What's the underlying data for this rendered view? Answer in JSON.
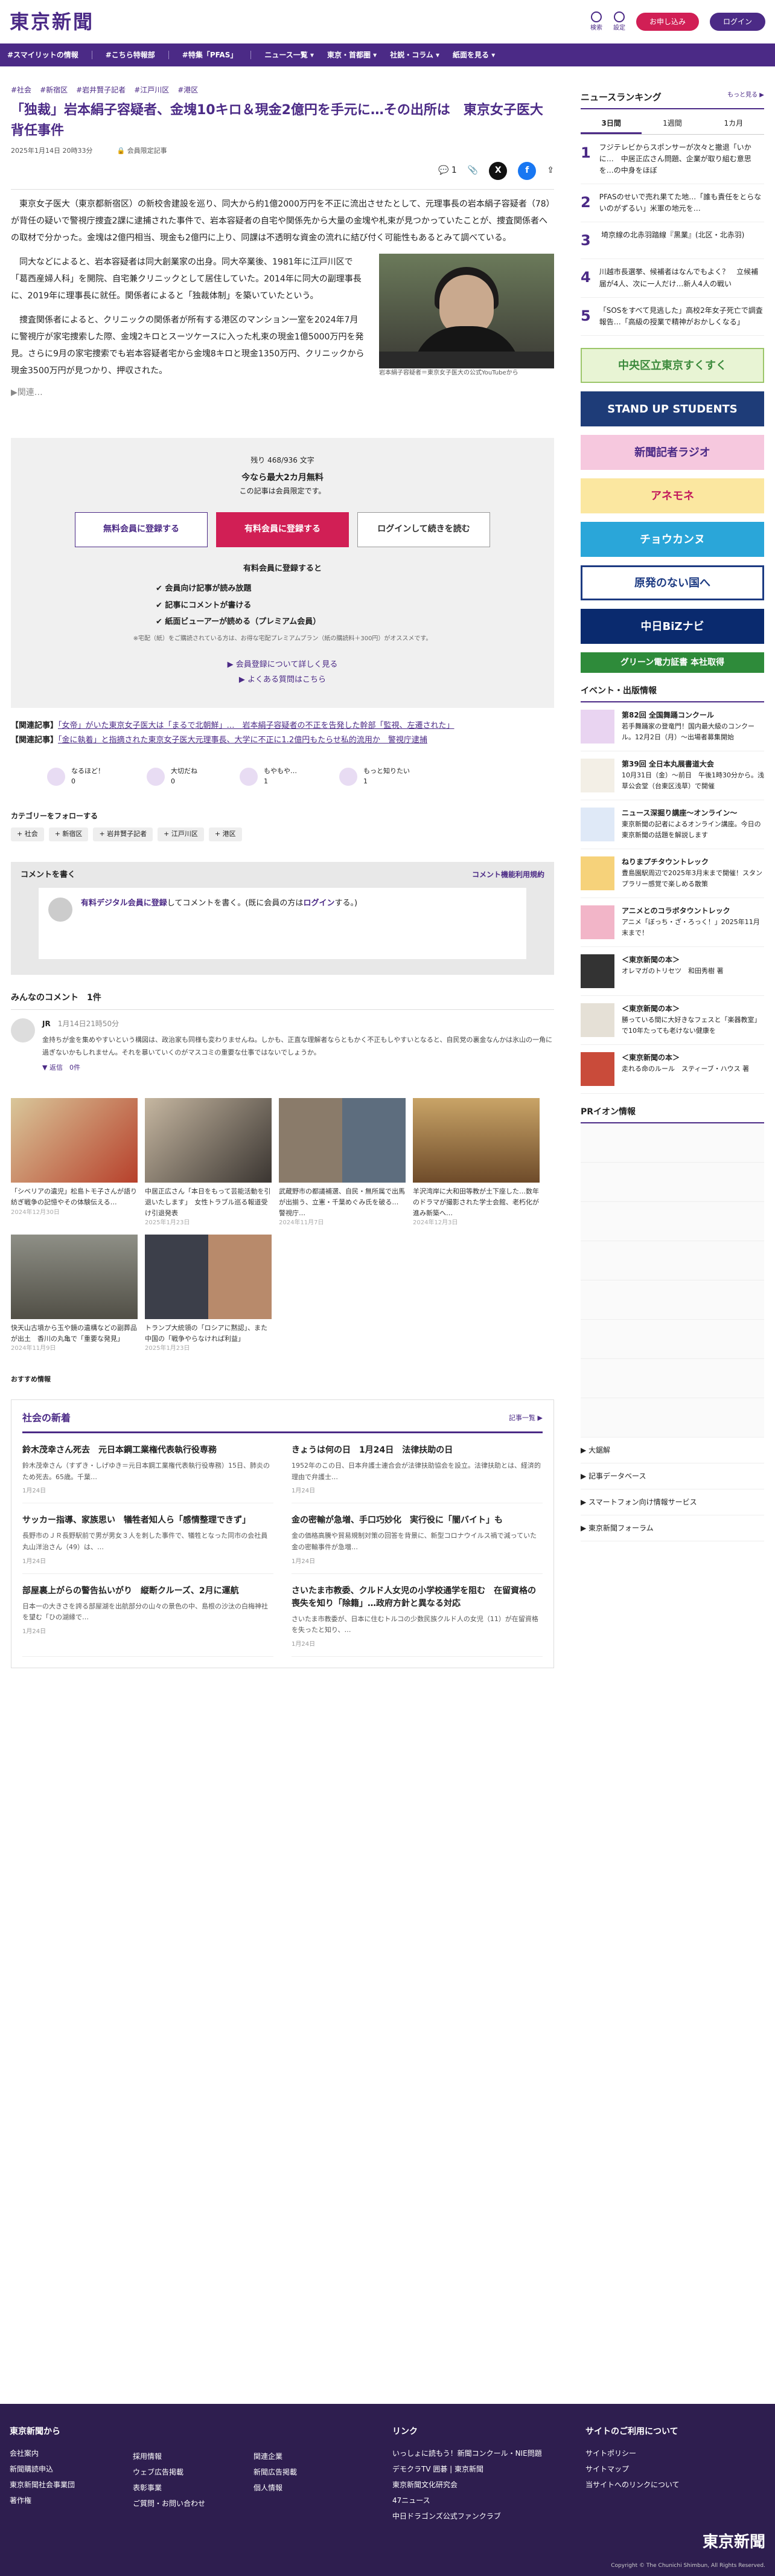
{
  "header": {
    "logo": "東京新聞",
    "search": "検索",
    "settings": "設定",
    "signup": "お申し込み",
    "login": "ログイン"
  },
  "nav": [
    "#スマイリットの情報",
    "#こちら特報部",
    "#特集「PFAS」",
    "ニュース一覧 ▾",
    "東京・首都圏 ▾",
    "社説・コラム ▾",
    "紙面を見る ▾"
  ],
  "article": {
    "tags": [
      "#社会",
      "#新宿区",
      "#岩井賢子記者",
      "#江戸川区",
      "#港区"
    ],
    "title": "「独裁」岩本絹子容疑者、金塊10キロ＆現金2億円を手元に…その出所は　東京女子医大背任事件",
    "date": "2025年1月14日 20時33分",
    "members": "会員限定記事",
    "comments": "1",
    "p1": "東京女子医大（東京都新宿区）の新校舎建設を巡り、同大から約1億2000万円を不正に流出させたとして、元理事長の岩本絹子容疑者（78）が背任の疑いで警視庁捜査2課に逮捕された事件で、岩本容疑者の自宅や関係先から大量の金塊や札束が見つかっていたことが、捜査関係者への取材で分かった。金塊は2億円相当、現金も2億円に上り、同課は不透明な資金の流れに結び付く可能性もあるとみて調べている。",
    "p2": "同大などによると、岩本容疑者は同大創業家の出身。同大卒業後、1981年に江戸川区で「葛西産婦人科」を開院、自宅兼クリニックとして居住していた。2014年に同大の副理事長に、2019年に理事長に就任。関係者によると「独裁体制」を築いていたという。",
    "p3": "捜査関係者によると、クリニックの関係者が所有する港区のマンション一室を2024年7月に警視庁が家宅捜索した際、金塊2キロとスーツケースに入った札束の現金1億5000万円を発見。さらに9月の家宅捜索でも岩本容疑者宅から金塊8キロと現金1350万円、クリニックから現金3500万円が見つかり、押収された。",
    "caption": "岩本絹子容疑者＝東京女子医大の公式YouTubeから",
    "more": "▶関連…"
  },
  "paywall": {
    "remain": "残り 468/936 文字",
    "promo": "今なら最大2カ月無料",
    "sub": "この記事は会員限定です。",
    "b1": "無料会員に登録する",
    "b2": "有料会員に登録する",
    "b3": "ログインして続きを読む",
    "benefit_title": "有料会員に登録すると",
    "benefits": [
      "✔ 会員向け記事が読み放題",
      "✔ 記事にコメントが書ける",
      "✔ 紙面ビューアーが読める（プレミアム会員）"
    ],
    "note": "※宅配（紙）をご購読されている方は、お得な宅配プレミアムプラン（紙の購読料＋300円）がオススメです。",
    "l1": "▶ 会員登録について詳しく見る",
    "l2": "▶ よくある質問はこちら"
  },
  "related": [
    {
      "label": "【関連記事】",
      "link": "「女帝」がいた東京女子医大は「まるで北朝鮮」…　岩本絹子容疑者の不正を告発した幹部「監視、左遷された」"
    },
    {
      "label": "【関連記事】",
      "link": "「金に執着」と指摘された東京女子医大元理事長、大学に不正に1.2億円もたらせ私的流用か　警視庁逮捕"
    }
  ],
  "reactions": [
    "なるほど！",
    "大切だね",
    "もやもや…",
    "もっと知りたい"
  ],
  "reaction_counts": [
    "0",
    "0",
    "1",
    "1"
  ],
  "follow": {
    "title": "カテゴリーをフォローする",
    "chips": [
      "+ 社会",
      "+ 新宿区",
      "+ 岩井賢子記者",
      "+ 江戸川区",
      "+ 港区"
    ]
  },
  "comment_form": {
    "title": "コメントを書く",
    "rule": "コメント機能利用規約",
    "prompt_a": "有料デジタル会員に登録",
    "prompt_b": "してコメントを書く。(既に会員の方は",
    "prompt_c": "ログイン",
    "prompt_d": "する。)"
  },
  "comments": {
    "title": "みんなのコメント",
    "count": "1件",
    "user": "JR",
    "date": "1月14日21時50分",
    "text": "金持ちが金を集めやすいという構図は、政治家も同様も変わりませんね。しかも、正直な理解者ならともかく不正もしやすいとなると、自民党の裏金なんかは氷山の一角に過ぎないかもしれません。それを暴いていくのがマスコミの重要な仕事ではないでしょうか。",
    "reply": "▼ 返信　0件",
    "report": "問題を報告"
  },
  "thumbs": [
    {
      "cap": "「シベリアの遺児」松島トモ子さんが語り紡ぎ戦争の記憶やその体験伝える…",
      "date": "2024年12月30日"
    },
    {
      "cap": "中居正広さん「本日をもって芸能活動を引退いたします」　女性トラブル巡る報道受け引退発表",
      "date": "2025年1月23日"
    },
    {
      "cap": "武蔵野市の都議補選、自民・無所属で出馬が出揃う、立憲・千葉めぐみ氏を破る…　警視庁…",
      "date": "2024年11月7日"
    },
    {
      "cap": "羊沢湾岸に大和田等教が土下座した…数年のドラマが撮影された学士会館、老朽化が進み新築へ…",
      "date": "2024年12月3日"
    },
    {
      "cap": "快天山古墳から玉や鏡の遺構などの副葬品が出土　香川の丸亀で「重要な発見」",
      "date": "2024年11月9日"
    },
    {
      "cap": "トランプ大統領の「ロシアに黙認」、また中国の「戦争やらなければ利益」",
      "date": "2025年1月23日"
    }
  ],
  "reco": "おすすめ情報",
  "social_news": {
    "title": "社会の新着",
    "more": "記事一覧 ▶",
    "items": [
      {
        "t": "鈴木茂幸さん死去　元日本鋼工業権代表執行役専務",
        "s": "鈴木茂幸さん（すずき・しげゆき＝元日本鋼工業権代表執行役専務）15日、肺炎のため死去。65歳。千葉…",
        "d": "1月24日"
      },
      {
        "t": "きょうは何の日　1月24日　法律扶助の日",
        "s": "1952年のこの日、日本弁護士連合会が法律扶助協会を設立。法律扶助とは、経済的理由で弁護士…",
        "d": "1月24日"
      },
      {
        "t": "サッカー指導、家族思い　犠牲者知人ら「感情整理できず」",
        "s": "長野市のＪＲ長野駅前で男が男女３人を刺した事件で、犠牲となった同市の会社員丸山洋治さん（49）は、…",
        "d": "1月24日"
      },
      {
        "t": "金の密輸が急増、手口巧妙化　実行役に「闇バイト」も",
        "s": "金の価格高騰や貿易規制対策の回答を背景に、新型コロナウイルス禍で減っていた金の密輸事件が急増…",
        "d": "1月24日"
      },
      {
        "t": "部屋裏上がらの警告払いがり　縦断クルーズ、2月に運航",
        "s": "日本一の大きさを誇る部屋湖を出航部分の山々の景色の中、島根の沙汰の白梅神社を望む「ひの湖縁で…",
        "d": "1月24日"
      },
      {
        "t": "さいたま市教委、クルド人女児の小学校通学を阻む　在留資格の喪失を知り「除籍」…政府方針と異なる対応",
        "s": "さいたま市教委が、日本に住むトルコの少数民族クルド人の女児（11）が在留資格を失ったと知り、…",
        "d": "1月24日"
      }
    ]
  },
  "ranking": {
    "title": "ニュースランキング",
    "more": "もっと見る ▶",
    "tabs": [
      "3日間",
      "1週間",
      "1カ月"
    ],
    "items": [
      {
        "n": "1",
        "t": "フジテレビからスポンサーが次々と撤退「いかに…　中居正広さん問題、企業が取り組む意思を…の中身をほぼ"
      },
      {
        "n": "2",
        "t": "PFASのせいで売れ果てた地…「誰も責任をとらないのがずるい」米軍の地元を…"
      },
      {
        "n": "3",
        "t": "埼京線の北赤羽踏線『黒業』(北区・北赤羽)"
      },
      {
        "n": "4",
        "t": "川越市長選挙、候補者はなんでもよく？　立候補届が4人、次に一人だけ…新人4人の戦い"
      },
      {
        "n": "5",
        "t": "「SOSをすべて見逃した」高校2年女子死亡で調査報告…「高級の授業で精神がおかしくなる」"
      }
    ]
  },
  "banners": [
    "中央区立東京すくすく",
    "STAND UP STUDENTS",
    "新聞記者ラジオ",
    "アネモネ",
    "チョウカンヌ",
    "原発のない国へ",
    "中日BiZナビ",
    "グリーン電力証書 本社取得"
  ],
  "events": {
    "title": "イベント・出版情報",
    "items": [
      {
        "b": "第82回 全国舞踊コンクール",
        "t": "若手舞踊家の登竜門！国内最大級のコンクール。12月2日（月）～出場者募集開始"
      },
      {
        "b": "第39回 全日本丸展書道大会",
        "t": "10月31日（金）～前日　午後1時30分から。浅草公会堂（台東区浅草）で開催"
      },
      {
        "b": "ニュース深掘り講座〜オンライン〜",
        "t": "東京新聞の記者によるオンライン講座。今日の東京新聞の話題を解説します"
      },
      {
        "b": "ねりまプチタウントレック",
        "t": "豊島園駅周辺で2025年3月末まで開催！スタンプラリー感覚で楽しめる散策"
      },
      {
        "b": "アニメとのコラボタウントレック",
        "t": "アニメ「ぼっち・ざ・ろっく！」2025年11月末まで！"
      },
      {
        "b": "＜東京新聞の本＞",
        "t": "オレマガのトリセツ　和田秀樹 著"
      },
      {
        "b": "＜東京新聞の本＞",
        "t": "勝っている間に大好きなフェスと「楽器教室」で10年たっても老けない健康を"
      },
      {
        "b": "＜東京新聞の本＞",
        "t": "走れる命のルール　スティーブ・ハウス 著"
      }
    ]
  },
  "side_links": [
    "▶ 大鋸解",
    "▶ 記事データベース",
    "▶ スマートフォン向け情報サービス",
    "▶ 東京新聞フォーラム"
  ],
  "pr": {
    "title": "PRイオン情報"
  },
  "footer": {
    "c1": {
      "h": "東京新聞から",
      "items": [
        "会社案内",
        "新聞購読申込",
        "東京新聞社会事業団",
        "著作権"
      ]
    },
    "c2": {
      "h": "",
      "items": [
        "採用情報",
        "ウェブ広告掲載",
        "表彰事業",
        "ご質問・お問い合わせ"
      ]
    },
    "c3": {
      "h": "",
      "items": [
        "関連企業",
        "新聞広告掲載",
        "個人情報"
      ]
    },
    "c4": {
      "h": "リンク",
      "items": [
        "いっしょに読もう！新聞コンクール・NIE問題",
        "デモクラTV 囲碁 | 東京新聞",
        "東京新聞文化研究会",
        "47ニュース",
        "中日ドラゴンズ公式ファンクラブ"
      ]
    },
    "c5": {
      "h": "サイトのご利用について",
      "items": [
        "サイトポリシー",
        "サイトマップ",
        "当サイトへのリンクについて"
      ]
    },
    "logo": "東京新聞",
    "copy": "Copyright © The Chunichi Shimbun, All Rights Reserved."
  }
}
